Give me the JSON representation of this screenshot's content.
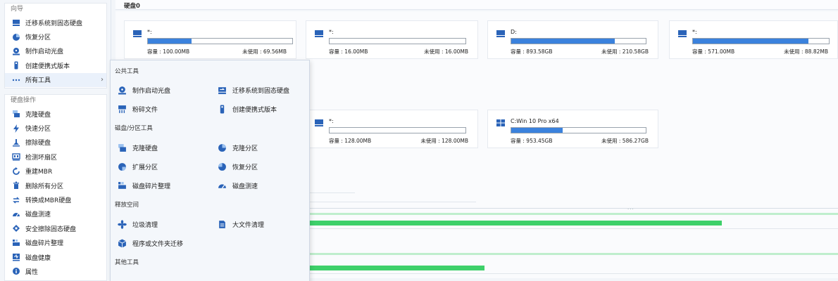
{
  "sidebar": {
    "wizard_section": {
      "title": "向导",
      "items": [
        {
          "label": "迁移系统到固态硬盘"
        },
        {
          "label": "恢复分区"
        },
        {
          "label": "制作启动光盘"
        },
        {
          "label": "创建便携式版本"
        },
        {
          "label": "所有工具",
          "chevron": "›"
        }
      ]
    },
    "disk_ops_section": {
      "title": "硬盘操作",
      "items": [
        {
          "label": "克隆硬盘"
        },
        {
          "label": "快速分区"
        },
        {
          "label": "擦除硬盘"
        },
        {
          "label": "检测坏扇区"
        },
        {
          "label": "重建MBR"
        },
        {
          "label": "删除所有分区"
        },
        {
          "label": "转换成MBR硬盘"
        },
        {
          "label": "磁盘测速"
        },
        {
          "label": "安全擦除固态硬盘"
        },
        {
          "label": "磁盘碎片整理"
        },
        {
          "label": "磁盘健康"
        },
        {
          "label": "属性"
        }
      ]
    }
  },
  "disk_header": {
    "title": "硬盘0"
  },
  "partitions_row1": [
    {
      "name": "*:",
      "capacity": "容量 : 100.00MB",
      "free": "未使用 : 69.56MB",
      "used_fraction": 0.3
    },
    {
      "name": "*:",
      "capacity": "容量 : 16.00MB",
      "free": "未使用 : 16.00MB",
      "used_fraction": 0.0
    },
    {
      "name": "D:",
      "capacity": "容量 : 893.58GB",
      "free": "未使用 : 210.58GB",
      "used_fraction": 0.77
    },
    {
      "name": "*:",
      "capacity": "容量 : 571.00MB",
      "free": "未使用 : 88.82MB",
      "used_fraction": 0.85
    }
  ],
  "partitions_row2": [
    {
      "name": "*:",
      "capacity": "容量 : 128.00MB",
      "free": "未使用 : 128.00MB",
      "used_fraction": 0.0
    },
    {
      "name": "C:Win 10 Pro x64",
      "capacity": "容量 : 953.45GB",
      "free": "未使用 : 586.27GB",
      "used_fraction": 0.38
    }
  ],
  "usage_bars": [
    {
      "fraction": 0.78
    },
    {
      "fraction": 0.33
    }
  ],
  "popup": {
    "sections": {
      "common": "公共工具",
      "disk_tools": "磁盘/分区工具",
      "free_space": "释放空间",
      "other": "其他工具"
    },
    "items": {
      "make_boot_disc": "制作启动光盘",
      "migrate_os": "迁移系统到固态硬盘",
      "shred_files": "粉碎文件",
      "create_portable": "创建便携式版本",
      "clone_disk": "克隆硬盘",
      "clone_partition": "克隆分区",
      "extend_partition": "扩展分区",
      "recover_partition": "恢复分区",
      "defrag": "磁盘碎片整理",
      "disk_speed": "磁盘测速",
      "junk_cleanup": "垃圾清理",
      "large_file_cleanup": "大文件清理",
      "app_migration": "程序或文件夹迁移"
    }
  },
  "colors": {
    "accent_blue": "#3b82dd",
    "usage_green": "#3ed06a",
    "popup_bg": "#f4f7fb"
  }
}
